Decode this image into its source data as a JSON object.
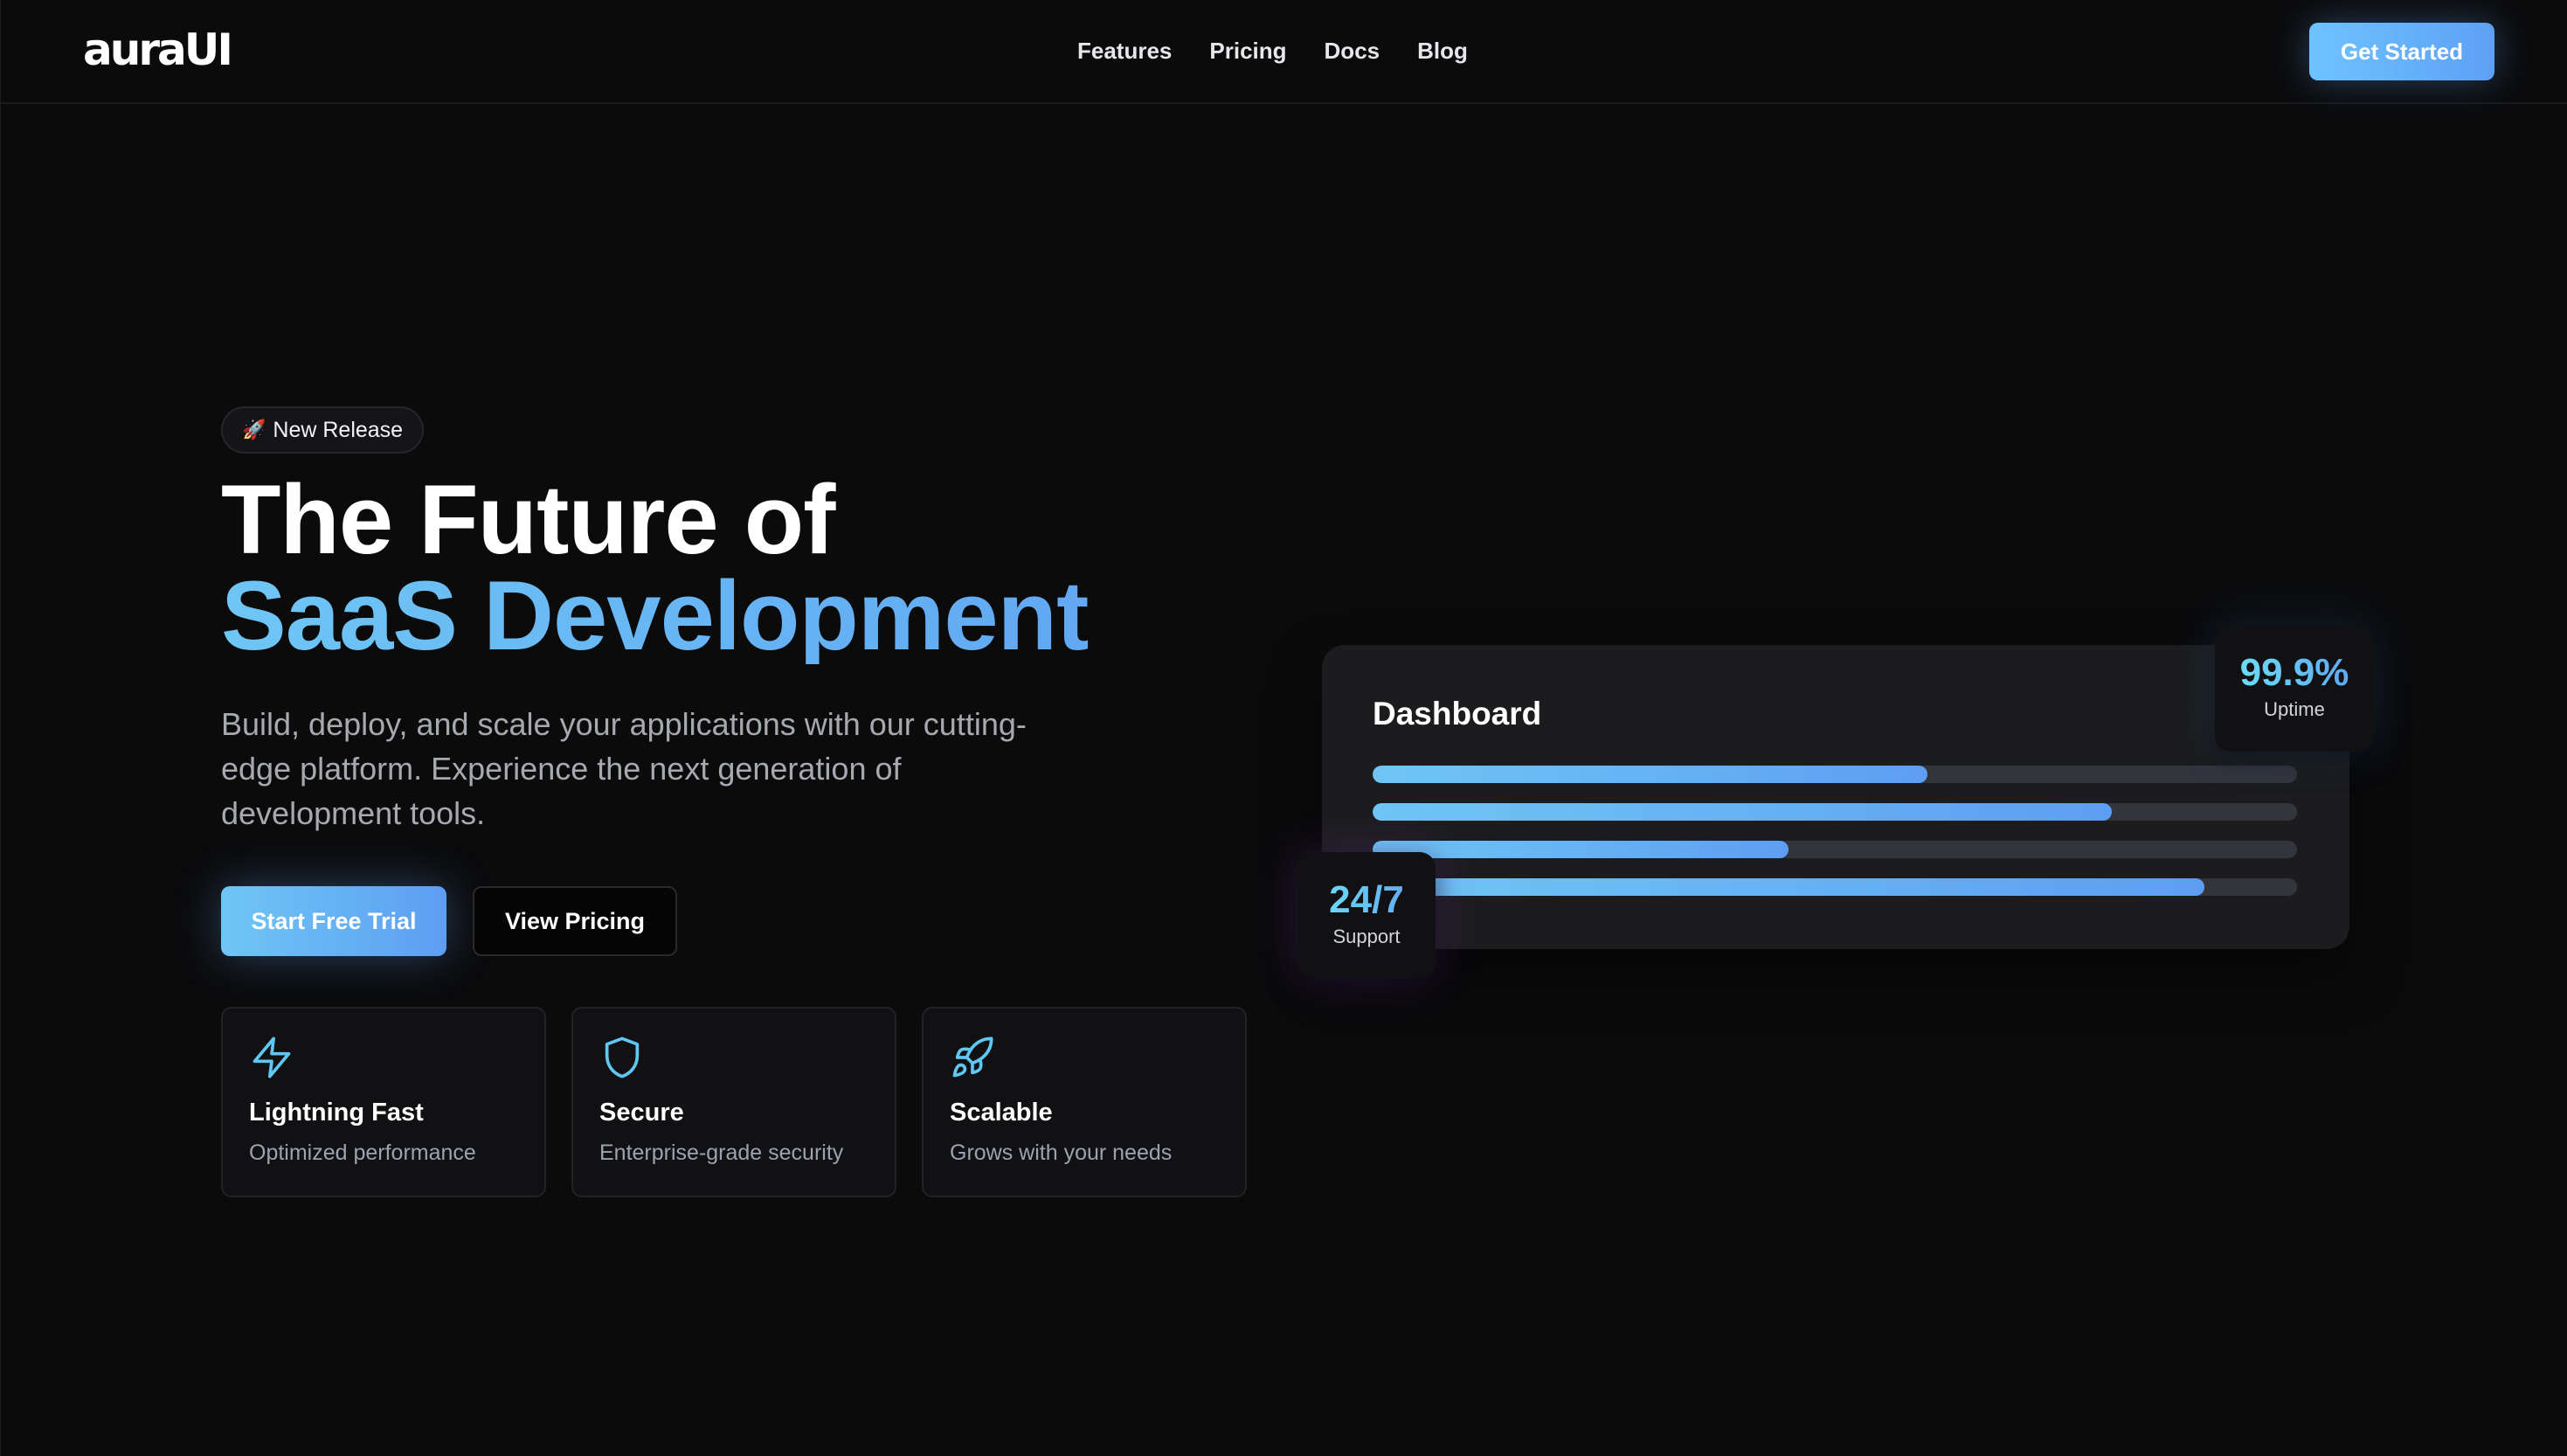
{
  "nav": {
    "logo": "auraUI",
    "links": [
      "Features",
      "Pricing",
      "Docs",
      "Blog"
    ],
    "cta": "Get Started"
  },
  "hero": {
    "badge_emoji": "🚀",
    "badge": "New Release",
    "title_line1": "The Future of",
    "title_line2": "SaaS Development",
    "description": "Build, deploy, and scale your applications with our cutting-edge platform. Experience the next generation of development tools.",
    "primary_button": "Start Free Trial",
    "secondary_button": "View Pricing"
  },
  "features": [
    {
      "icon": "lightning-icon",
      "title": "Lightning Fast",
      "description": "Optimized performance"
    },
    {
      "icon": "shield-icon",
      "title": "Secure",
      "description": "Enterprise-grade security"
    },
    {
      "icon": "rocket-icon",
      "title": "Scalable",
      "description": "Grows with your needs"
    }
  ],
  "dashboard": {
    "title": "Dashboard",
    "progress": [
      0.6,
      0.8,
      0.45,
      0.9
    ]
  },
  "stats": {
    "uptime": {
      "value": "99.9%",
      "label": "Uptime"
    },
    "support": {
      "value": "24/7",
      "label": "Support"
    }
  },
  "colors": {
    "background": "#0b0b0c",
    "accent_start": "#6ec6f5",
    "accent_end": "#5e9ef2",
    "icon_color": "#5ec8f2"
  }
}
